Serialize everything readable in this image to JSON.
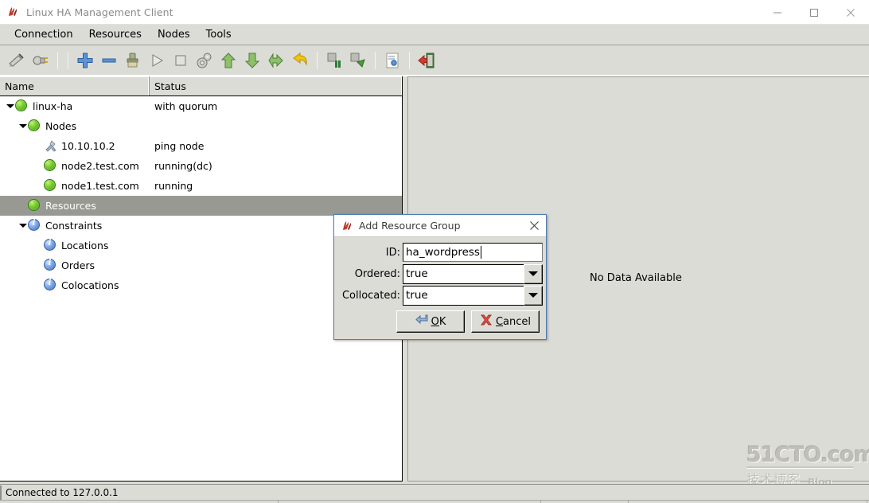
{
  "window": {
    "title": "Linux HA Management Client",
    "icon": "app-icon",
    "controls": {
      "minimize": "minimize-icon",
      "maximize": "maximize-icon",
      "close": "close-icon"
    }
  },
  "menubar": {
    "items": [
      {
        "label": "Connection",
        "name": "menu-connection"
      },
      {
        "label": "Resources",
        "name": "menu-resources"
      },
      {
        "label": "Nodes",
        "name": "menu-nodes"
      },
      {
        "label": "Tools",
        "name": "menu-tools"
      }
    ]
  },
  "toolbar": {
    "buttons": [
      {
        "icon": "connect-icon",
        "title": "Connect"
      },
      {
        "icon": "disconnect-plug-icon",
        "title": "Disconnect"
      },
      {
        "sep": true
      },
      {
        "sep": true
      },
      {
        "icon": "add-plus-icon",
        "title": "Add"
      },
      {
        "icon": "remove-minus-icon",
        "title": "Remove"
      },
      {
        "icon": "cleanup-icon",
        "title": "Cleanup"
      },
      {
        "icon": "start-play-icon",
        "title": "Start"
      },
      {
        "icon": "stop-square-icon",
        "title": "Stop"
      },
      {
        "icon": "gears-icon",
        "title": "Manage"
      },
      {
        "icon": "arrow-up-icon",
        "title": "Move Up"
      },
      {
        "icon": "arrow-down-icon",
        "title": "Move Down"
      },
      {
        "icon": "migrate-arrow-icon",
        "title": "Migrate"
      },
      {
        "icon": "undo-arrow-icon",
        "title": "Undo"
      },
      {
        "sep": true
      },
      {
        "icon": "standby-node-icon",
        "title": "Standby"
      },
      {
        "icon": "active-node-icon",
        "title": "Active"
      },
      {
        "sep": true
      },
      {
        "icon": "document-icon",
        "title": "Document"
      },
      {
        "sep": true
      },
      {
        "icon": "exit-door-icon",
        "title": "Exit"
      }
    ]
  },
  "tree": {
    "columns": [
      {
        "label": "Name",
        "name": "column-header-name"
      },
      {
        "label": "Status",
        "name": "column-header-status"
      }
    ],
    "rows": [
      {
        "name": "linux-ha",
        "status": "with quorum",
        "indent": 0,
        "twisty": "open",
        "icon": "green-ball-icon",
        "selected": false
      },
      {
        "name": "Nodes",
        "status": "",
        "indent": 1,
        "twisty": "open",
        "icon": "green-ball-icon",
        "selected": false
      },
      {
        "name": "10.10.10.2",
        "status": "ping node",
        "indent": 2,
        "twisty": "none",
        "icon": "ping-node-icon",
        "selected": false
      },
      {
        "name": "node2.test.com",
        "status": "running(dc)",
        "indent": 2,
        "twisty": "none",
        "icon": "green-ball-icon",
        "selected": false
      },
      {
        "name": "node1.test.com",
        "status": "running",
        "indent": 2,
        "twisty": "none",
        "icon": "green-ball-icon",
        "selected": false
      },
      {
        "name": "Resources",
        "status": "",
        "indent": 1,
        "twisty": "none",
        "icon": "green-ball-icon",
        "selected": true
      },
      {
        "name": "Constraints",
        "status": "",
        "indent": 1,
        "twisty": "open",
        "icon": "info-ball-icon",
        "selected": false
      },
      {
        "name": "Locations",
        "status": "",
        "indent": 2,
        "twisty": "none",
        "icon": "info-ball-icon",
        "selected": false
      },
      {
        "name": "Orders",
        "status": "",
        "indent": 2,
        "twisty": "none",
        "icon": "info-ball-icon",
        "selected": false
      },
      {
        "name": "Colocations",
        "status": "",
        "indent": 2,
        "twisty": "none",
        "icon": "info-ball-icon",
        "selected": false
      }
    ]
  },
  "right_pane": {
    "empty_message": "No Data Available"
  },
  "dialog": {
    "title": "Add Resource Group",
    "icon": "app-icon",
    "close_icon": "close-icon",
    "fields": {
      "id": {
        "label": "ID:",
        "value": "ha_wordpress",
        "placeholder": ""
      },
      "ordered": {
        "label": "Ordered:",
        "value": "true",
        "options": [
          "true",
          "false"
        ]
      },
      "collocated": {
        "label": "Collocated:",
        "value": "true",
        "options": [
          "true",
          "false"
        ]
      }
    },
    "buttons": {
      "ok": {
        "mnemonic": "O",
        "rest": "K",
        "icon": "enter-arrow-icon"
      },
      "cancel": {
        "lead": "C",
        "rest": "ancel",
        "prefix": "",
        "icon": "red-x-icon"
      }
    }
  },
  "statusbar": {
    "text": "Connected to 127.0.0.1"
  },
  "watermark": {
    "main": "51CTO.com",
    "chinese": "技术博客",
    "blog": "Blog"
  },
  "colors": {
    "chrome": "#dcdcd7",
    "selection": "#999993",
    "dialog_border": "#4d7db5",
    "node_green": "#76cc2c",
    "info_blue": "#4572bd"
  }
}
